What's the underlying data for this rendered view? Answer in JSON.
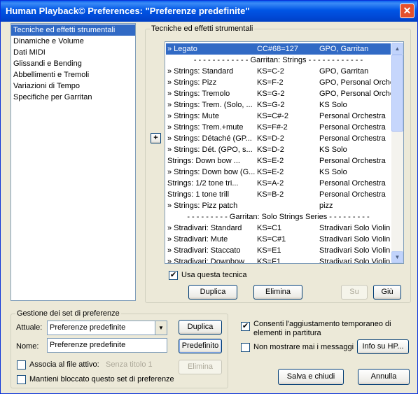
{
  "window": {
    "title": "Human Playback© Preferences: \"Preferenze predefinite\"",
    "close_glyph": "✕"
  },
  "categories": {
    "items": [
      {
        "label": "Tecniche ed effetti strumentali",
        "selected": true
      },
      {
        "label": "Dinamiche e Volume"
      },
      {
        "label": "Dati MIDI"
      },
      {
        "label": "Glissandi e Bending"
      },
      {
        "label": "Abbellimenti e Tremoli"
      },
      {
        "label": "Variazioni di Tempo"
      },
      {
        "label": "Specifiche per Garritan"
      }
    ]
  },
  "techniques": {
    "group_label": "Tecniche ed effetti strumentali",
    "expand_glyph": "+",
    "rows": [
      {
        "name": "» Legato",
        "key": "CC#68=127",
        "target": "GPO, Garritan",
        "selected": true
      },
      {
        "separator": "- - - - - - - - - - - - Garritan: Strings - - - - - - - - - - - -"
      },
      {
        "name": "» Strings: Standard",
        "key": "KS=C-2",
        "target": "GPO, Garritan"
      },
      {
        "name": "» Strings: Pizz",
        "key": "KS=F-2",
        "target": "GPO, Personal Orches"
      },
      {
        "name": "» Strings: Tremolo",
        "key": "KS=G-2",
        "target": "GPO, Personal Orches"
      },
      {
        "name": "» Strings: Trem. (Solo, ...",
        "key": "KS=G-2",
        "target": "KS Solo"
      },
      {
        "name": "» Strings: Mute",
        "key": "KS=C#-2",
        "target": "Personal Orchestra"
      },
      {
        "name": "» Strings: Trem.+mute",
        "key": "KS=F#-2",
        "target": "Personal Orchestra"
      },
      {
        "name": "» Strings: Détaché (GP...",
        "key": "KS=D-2",
        "target": "Personal Orchestra"
      },
      {
        "name": "» Strings: Dét. (GPO, s...",
        "key": "KS=D-2",
        "target": "KS Solo"
      },
      {
        "name": "Strings: Down bow ...",
        "key": "KS=E-2",
        "target": "Personal Orchestra"
      },
      {
        "name": "» Strings: Down bow (G...",
        "key": "KS=E-2",
        "target": "KS Solo"
      },
      {
        "name": "Strings: 1/2 tone tri...",
        "key": "KS=A-2",
        "target": "Personal Orchestra"
      },
      {
        "name": "Strings: 1 tone trill",
        "key": "KS=B-2",
        "target": "Personal Orchestra"
      },
      {
        "name": "» Strings: Pizz patch",
        "key": "",
        "target": "pizz"
      },
      {
        "separator": "- - - - - - - - - Garritan: Solo Strings Series - - - - - - - - -"
      },
      {
        "name": "» Stradivari: Standard",
        "key": "KS=C1",
        "target": "Stradivari Solo Violin"
      },
      {
        "name": "» Stradivari: Mute",
        "key": "KS=C#1",
        "target": "Stradivari Solo Violin"
      },
      {
        "name": "» Stradivari: Staccato",
        "key": "KS=E1",
        "target": "Stradivari Solo Violin"
      },
      {
        "name": "» Stradivari: Downbow",
        "key": "KS=F1",
        "target": "Stradivari Solo Violin"
      }
    ],
    "use_technique_label": "Usa questa tecnica",
    "use_technique_checked": true,
    "duplicate_label": "Duplica",
    "delete_label": "Elimina",
    "up_label": "Su",
    "down_label": "Giù"
  },
  "presets": {
    "group_label": "Gestione dei set di preferenze",
    "current_label": "Attuale:",
    "current_value": "Preferenze predefinite",
    "duplicate_label": "Duplica",
    "name_label": "Nome:",
    "name_value": "Preferenze predefinite",
    "default_label": "Predefinito",
    "associate_label": "Associa al file attivo:",
    "associate_file": "Senza titolo 1",
    "delete_label": "Elimina",
    "keep_locked_label": "Mantieni bloccato questo set di preferenze",
    "associate_checked": false,
    "keep_locked_checked": false
  },
  "options": {
    "temp_adjust_label_1": "Consenti l'aggiustamento temporaneo di",
    "temp_adjust_label_2": "elementi in partitura",
    "temp_adjust_checked": true,
    "never_show_label": "Non mostrare mai i messaggi",
    "never_show_checked": false,
    "info_label": "Info su HP...",
    "save_close_label": "Salva e chiudi",
    "cancel_label": "Annulla"
  }
}
